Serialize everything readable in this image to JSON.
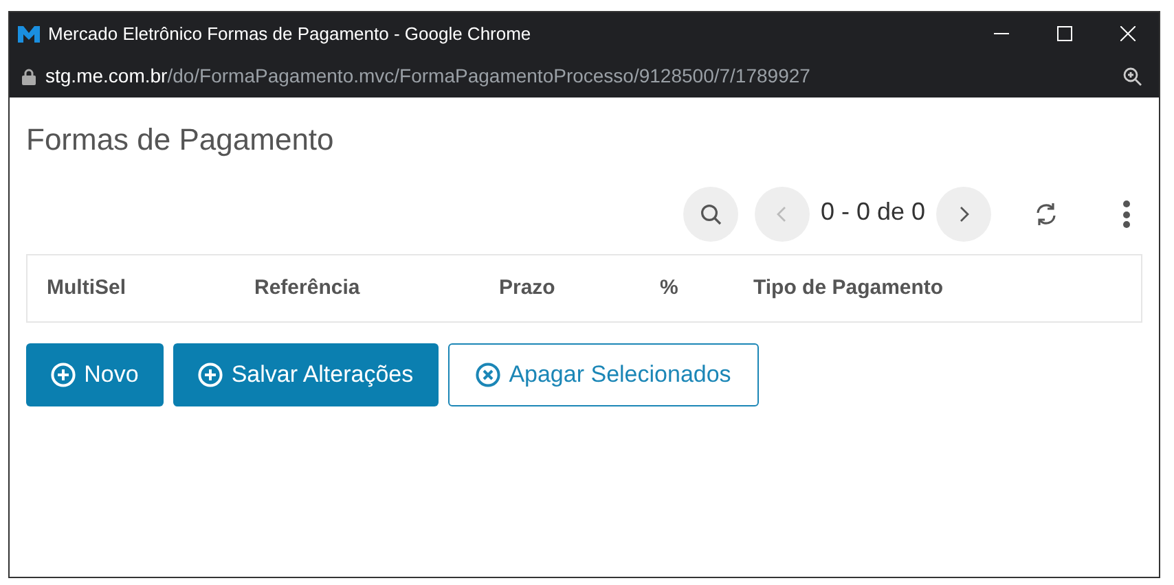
{
  "window": {
    "title": "Mercado Eletrônico Formas de Pagamento - Google Chrome",
    "url_host": "stg.me.com.br",
    "url_path": "/do/FormaPagamento.mvc/FormaPagamentoProcesso/9128500/7/1789927"
  },
  "page_title": "Formas de Pagamento",
  "pagination": {
    "range": "0 - 0 de 0",
    "prev_disabled": true
  },
  "table": {
    "columns": [
      "MultiSel",
      "Referência",
      "Prazo",
      "%",
      "Tipo de Pagamento"
    ]
  },
  "buttons": [
    {
      "label": "Novo",
      "kind": "primary"
    },
    {
      "label": "Salvar Alterações",
      "kind": "primary"
    },
    {
      "label": "Apagar Selecionados",
      "kind": "outline"
    }
  ]
}
